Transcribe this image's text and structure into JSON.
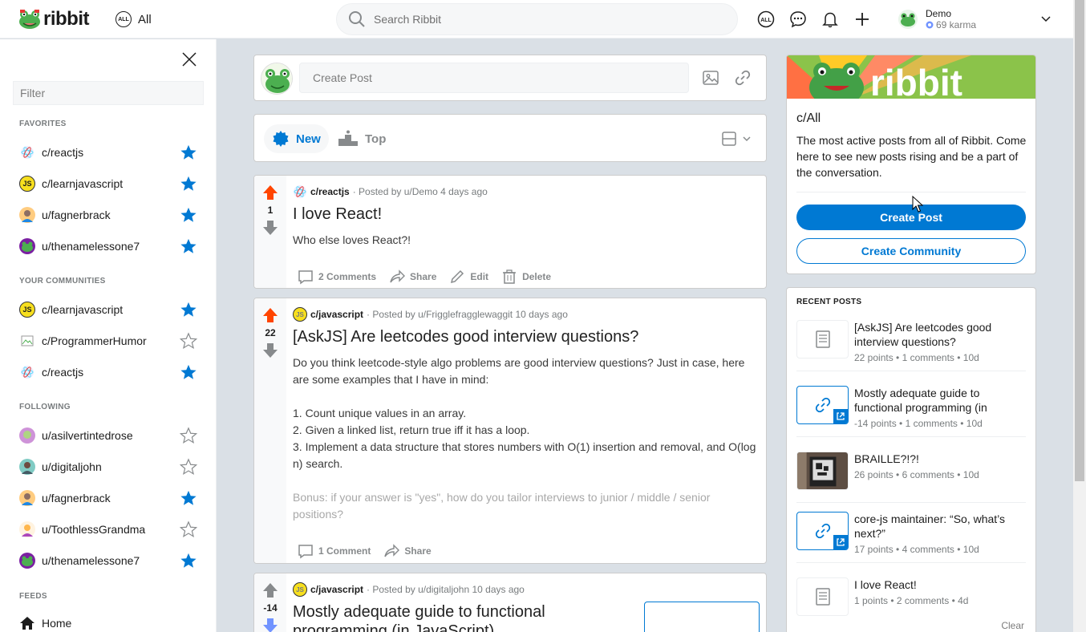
{
  "header": {
    "logo_text": "ribbit",
    "feed_label": "All",
    "all_badge": "ALL",
    "search_placeholder": "Search Ribbit",
    "user_name": "Demo",
    "user_karma": "69 karma"
  },
  "sidebar": {
    "filter_placeholder": "Filter",
    "favorites_heading": "FAVORITES",
    "favorites": [
      {
        "label": "c/reactjs",
        "starred": true
      },
      {
        "label": "c/learnjavascript",
        "starred": true
      },
      {
        "label": "u/fagnerbrack",
        "starred": true
      },
      {
        "label": "u/thenamelessone7",
        "starred": true
      }
    ],
    "communities_heading": "YOUR COMMUNITIES",
    "communities": [
      {
        "label": "c/learnjavascript",
        "starred": true
      },
      {
        "label": "c/ProgrammerHumor",
        "starred": false
      },
      {
        "label": "c/reactjs",
        "starred": true
      }
    ],
    "following_heading": "FOLLOWING",
    "following": [
      {
        "label": "u/asilvertintedrose",
        "starred": false
      },
      {
        "label": "u/digitaljohn",
        "starred": false
      },
      {
        "label": "u/fagnerbrack",
        "starred": true
      },
      {
        "label": "u/ToothlessGrandma",
        "starred": false
      },
      {
        "label": "u/thenamelessone7",
        "starred": true
      }
    ],
    "feeds_heading": "FEEDS",
    "feeds": [
      {
        "label": "Home"
      }
    ]
  },
  "create_post": {
    "placeholder": "Create Post"
  },
  "sort": {
    "new_label": "New",
    "top_label": "Top"
  },
  "posts": [
    {
      "score": "1",
      "community": "c/reactjs",
      "posted_by": "· Posted by u/Demo 4 days ago",
      "title": "I love React!",
      "text": "Who else loves React?!",
      "comments": "2 Comments",
      "share": "Share",
      "edit": "Edit",
      "delete": "Delete"
    },
    {
      "score": "22",
      "community": "c/javascript",
      "avatar_text": "JS",
      "posted_by": "· Posted by u/Frigglefragglewaggit 10 days ago",
      "title": "[AskJS] Are leetcodes good interview questions?",
      "text_lines": [
        "Do you think leetcode-style algo problems are good interview questions? Just in case, here are some examples that I have in mind:",
        "1. Count unique values in an array.",
        "2. Given a linked list, return true iff it has a loop.",
        "3. Implement a data structure that stores numbers with O(1) insertion and removal, and O(log n) search.",
        "Bonus: if your answer is \"yes\", how do you tailor interviews to junior / middle / senior positions?"
      ],
      "comments": "1 Comment",
      "share": "Share"
    },
    {
      "score": "-14",
      "community": "c/javascript",
      "avatar_text": "JS",
      "posted_by": "· Posted by u/digitaljohn 10 days ago",
      "title": "Mostly adequate guide to functional programming (in JavaScript)"
    }
  ],
  "about": {
    "banner_text": "ribbit",
    "title": "c/All",
    "description": "The most active posts from all of Ribbit. Come here to see new posts rising and be a part of the conversation.",
    "create_post": "Create Post",
    "create_community": "Create Community"
  },
  "recent": {
    "heading": "RECENT POSTS",
    "items": [
      {
        "title": "[AskJS] Are leetcodes good interview questions?",
        "meta": "22 points • 1 comments • 10d",
        "kind": "text"
      },
      {
        "title": "Mostly adequate guide to functional programming (in",
        "meta": "-14 points • 1 comments • 10d",
        "kind": "link"
      },
      {
        "title": "BRAILLE?!?!",
        "meta": "26 points • 6 comments • 10d",
        "kind": "image"
      },
      {
        "title": "core-js maintainer: “So, what’s next?”",
        "meta": "17 points • 4 comments • 10d",
        "kind": "link"
      },
      {
        "title": "I love React!",
        "meta": "1 points • 2 comments • 4d",
        "kind": "text"
      }
    ],
    "clear": "Clear"
  },
  "colors": {
    "accent": "#0079d3",
    "upvote": "#ff4500",
    "star": "#0079d3"
  }
}
